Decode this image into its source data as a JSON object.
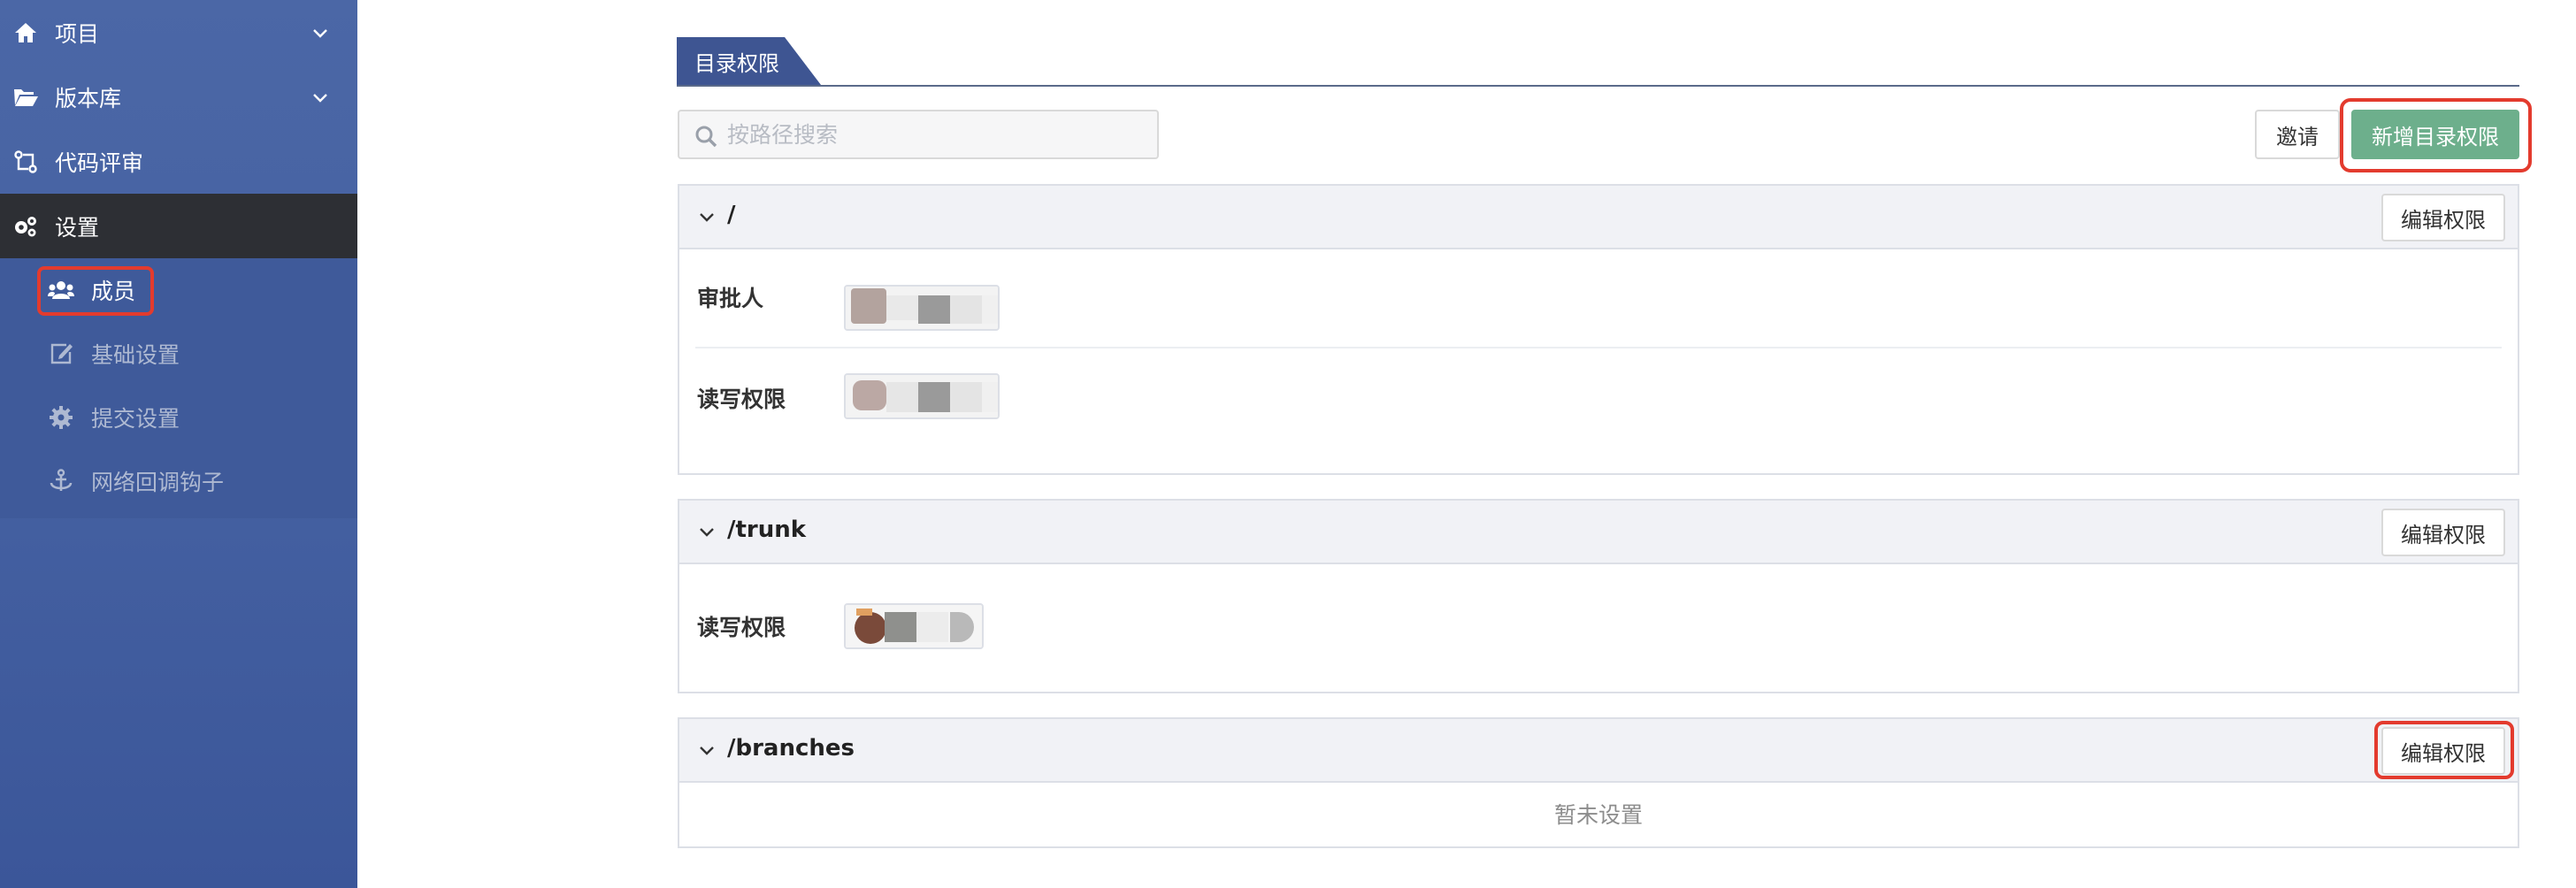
{
  "sidebar": {
    "items": [
      {
        "label": "项目",
        "icon": "home-icon"
      },
      {
        "label": "版本库",
        "icon": "folder-open-icon"
      },
      {
        "label": "代码评审",
        "icon": "code-review-icon"
      },
      {
        "label": "设置",
        "icon": "gears-icon"
      }
    ],
    "settings_sub": [
      {
        "label": "成员",
        "icon": "users-icon"
      },
      {
        "label": "基础设置",
        "icon": "edit-icon"
      },
      {
        "label": "提交设置",
        "icon": "cog-icon"
      },
      {
        "label": "网络回调钩子",
        "icon": "anchor-icon"
      }
    ]
  },
  "main": {
    "tab": "目录权限",
    "search": {
      "placeholder": "按路径搜索",
      "value": ""
    },
    "invite_label": "邀请",
    "add_label": "新增目录权限",
    "edit_label": "编辑权限",
    "panels": [
      {
        "path": "/",
        "rows": [
          {
            "label": "审批人"
          },
          {
            "label": "读写权限"
          }
        ]
      },
      {
        "path": "/trunk",
        "rows": [
          {
            "label": "读写权限"
          }
        ]
      },
      {
        "path": "/branches",
        "empty_text": "暂未设置"
      }
    ]
  },
  "colors": {
    "sidebar": "#4460a1",
    "active_nav": "#2d2f34",
    "tab": "#3e5592",
    "primary_green": "#6daf8c",
    "highlight_red": "#e33b2e"
  }
}
